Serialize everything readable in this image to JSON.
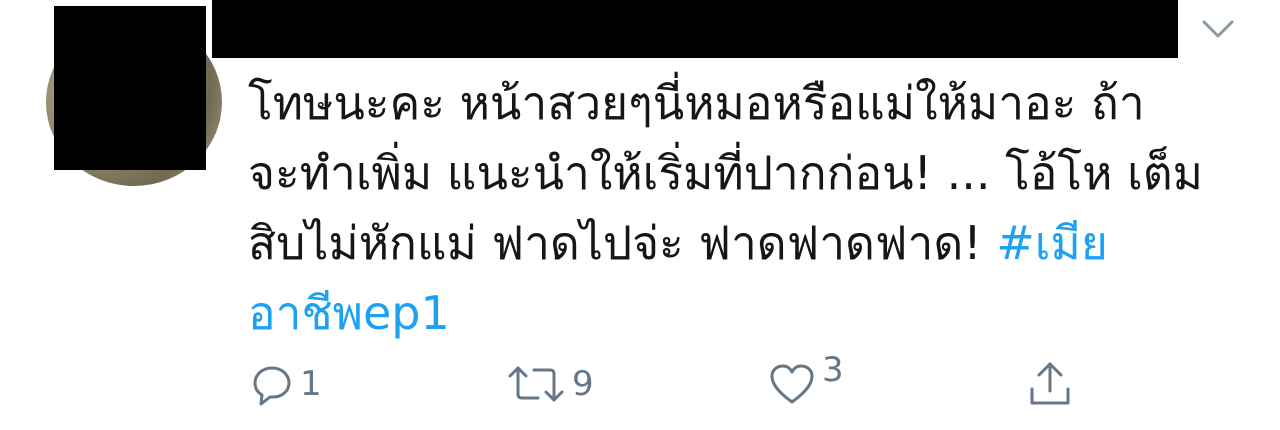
{
  "tweet": {
    "lines": [
      "โทษนะคะ หน้าสวยๆนี่หมอหรือแม่ให้มาอะ ถ้า",
      "จะทำเพิ่ม แนะนำให้เริ่มที่ปากก่อน! ... โอ้โห เต็ม",
      "สิบไม่หักแม่ ฟาดไปจ่ะ ฟาดฟาดฟาด! "
    ],
    "hashtag_part1": "#เมีย",
    "hashtag_part2": "อาชีพep1"
  },
  "actions": {
    "reply_count": "1",
    "retweet_count": "9",
    "like_count": "3"
  },
  "colors": {
    "text": "#14171a",
    "link": "#1da1f2",
    "icon": "#657786"
  }
}
